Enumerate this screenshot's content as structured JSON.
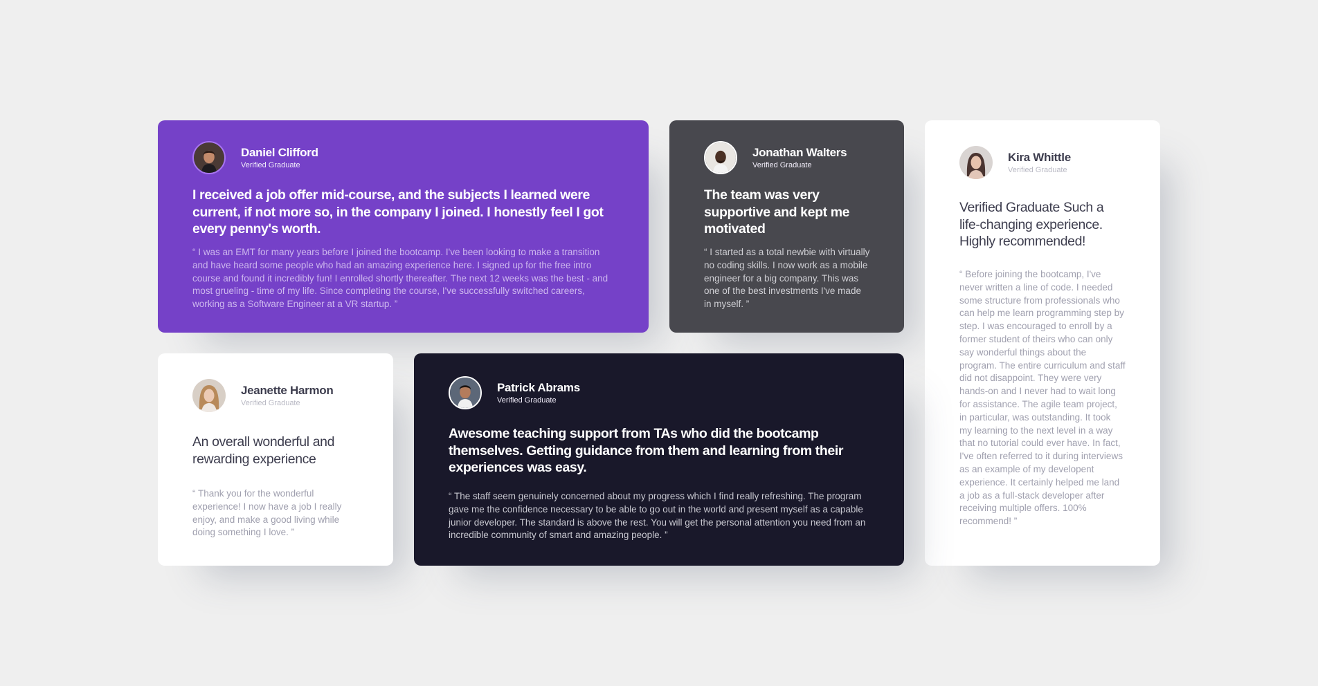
{
  "colors": {
    "background": "#efefef",
    "purple_card": "#7541c8",
    "grey_card": "#48484e",
    "white_card": "#ffffff",
    "dark_card": "#19182a"
  },
  "testimonials": [
    {
      "name": "Daniel Clifford",
      "status": "Verified Graduate",
      "avatar_icon": "man-portrait-avatar",
      "headline": "I received a job offer mid-course, and the subjects I learned were current, if not more so, in the company I joined. I honestly feel I got every penny's worth.",
      "quote": "“ I was an EMT for many years before I joined the bootcamp. I've been looking to make a transition and have heard some people who had an amazing experience here. I signed up for the free intro course and found it incredibly fun! I enrolled shortly thereafter. The next 12 weeks was the best - and most grueling - time of my life. Since completing the course, I've successfully switched careers, working as a Software Engineer at a VR startup. ”"
    },
    {
      "name": "Jonathan Walters",
      "status": "Verified Graduate",
      "avatar_icon": "man-portrait-avatar",
      "headline": "The team was very supportive and kept me motivated",
      "quote": "“ I started as a total newbie with virtually no coding skills. I now work as a mobile engineer for a big company. This was one of the best investments I've made in myself. ”"
    },
    {
      "name": "Kira Whittle",
      "status": "Verified Graduate",
      "avatar_icon": "woman-portrait-avatar",
      "headline": "Verified Graduate Such a life-changing experience. Highly recommended!",
      "quote": "“ Before joining the bootcamp, I've never written a line of code. I needed some structure from professionals who can help me learn programming step by step. I was encouraged to enroll by a former student of theirs who can only say wonderful things about the program. The entire curriculum and staff did not disappoint. They were very hands-on and I never had to wait long for assistance. The agile team project, in particular, was outstanding. It took my learning to the next level in a way that no tutorial could ever have. In fact, I've often referred to it during interviews as an example of my developent experience. It certainly helped me land a job as a full-stack developer after receiving multiple offers. 100% recommend! ”"
    },
    {
      "name": "Jeanette Harmon",
      "status": "Verified Graduate",
      "avatar_icon": "woman-portrait-avatar",
      "headline": "An overall wonderful and rewarding experience",
      "quote": "“ Thank you for the wonderful experience! I now have a job I really enjoy, and make a good living while doing something I love. ”"
    },
    {
      "name": "Patrick Abrams",
      "status": "Verified Graduate",
      "avatar_icon": "man-portrait-avatar",
      "headline": "Awesome teaching support from TAs who did the bootcamp themselves. Getting guidance from them and learning from their experiences was easy.",
      "quote": "“ The staff seem genuinely concerned about my progress which I find really refreshing. The program gave me the confidence necessary to be able to go out in the world and present myself as a capable junior developer. The standard is above the rest. You will get the personal attention you need from an incredible community of smart and amazing people. ”"
    }
  ]
}
